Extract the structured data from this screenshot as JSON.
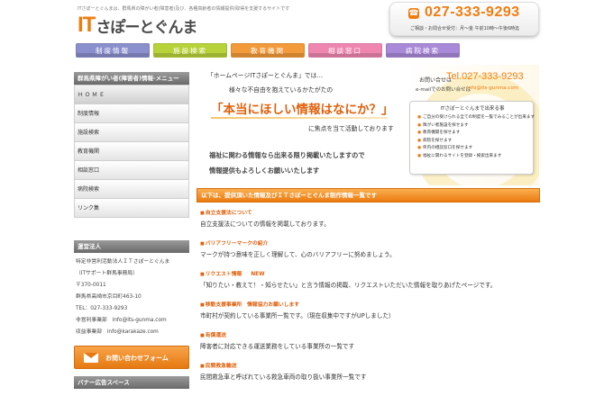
{
  "header": {
    "tagline": "ITさぽーとぐんまは、群馬県の障がい者(障害者)及び、各種高齢者の情報提供/取得を支援するサイトです",
    "logo_it": "IT",
    "logo_rest": "さぽーとぐんま",
    "phone_icon": "phone-icon",
    "phone": "027-333-9293",
    "hours": "ご相談・お問合せ受付：月～金 午前10時～午後6時迄"
  },
  "nav": [
    {
      "label": "制度情報",
      "color": "#8a8fcd"
    },
    {
      "label": "施設検索",
      "color": "#b8d23a"
    },
    {
      "label": "教育機関",
      "color": "#f39a3a"
    },
    {
      "label": "相談窓口",
      "color": "#ee86b0"
    },
    {
      "label": "病院検索",
      "color": "#a98ad8"
    }
  ],
  "sidebar": {
    "menu_title": "群馬県障がい者(障害者)情報-メニュー",
    "items": [
      "ＨＯＭＥ",
      "制度情報",
      "施設検索",
      "教育機関",
      "相談窓口",
      "病院検索",
      "リンク集"
    ],
    "org_title": "運営法人",
    "org_lines": [
      "特定非営利活動法人ＩＴさぽーとぐんま",
      "（ITサポート群馬事務局）",
      "〒370-0011",
      "群馬県高崎市京目町463-10",
      "TEL：027-333-9293",
      "非営利事業部　info@its-gunma.com",
      "収益事業部　info@karakaze.com"
    ],
    "contact_button": "お問い合わせフォーム",
    "banner_title": "バナー広告スペース"
  },
  "hero": {
    "line1": "「ホームページITさぽーとぐんま」では…",
    "line2": "様々な不自由を抱えているかたがたの",
    "big": "「本当にほしい情報はなにか？」",
    "line3": "に焦点を当て活動しております",
    "line4": "福祉に関わる情報なら出来る限り掲載いたしますので",
    "line5": "情報提供もよろしくお願いいたします",
    "contact_label": "お問い合せは",
    "contact_tel": "Tel.027-333-9293",
    "mail_label": "e-mailでのお問い合せは",
    "mail": "info@its-gunma.com",
    "list_title": "ITさぽーとぐんまで出来る事",
    "list_items": [
      "ご自分の受けられる全ての制度を一覧でみることが出来ます",
      "障がい者施設を探せます",
      "教育機関を探せます",
      "病院を探せます",
      "県内の相談窓口を探せます",
      "福祉に関わるサイトを登録・検索出来ます"
    ]
  },
  "main": {
    "section_title": "以下は、提供頂いた情報及びＩＴさぽーとぐんま制作情報一覧です",
    "items": [
      {
        "title": "自立支援法について",
        "body": "自立支援法についての情報を掲載しております。"
      },
      {
        "title": "バリアフリーマークの紹介",
        "body": "マークが持つ意味を正しく理解して、心のバリアフリーに努めましょう。"
      },
      {
        "title": "リクエスト情報",
        "new": "NEW",
        "body": "「知りたい・教えて！・知らせたい」と言う情報の掲載、リクエストいただいた情報を取りあげたページです。"
      },
      {
        "title": "移動支援事業所　情報協力お願いします",
        "body": "市町村が契約している事業所一覧です。（現在収集中ですがUPしました）"
      },
      {
        "title": "有償運送",
        "body": "障害者に対応できる運送業務をしている事業所の一覧です"
      },
      {
        "title": "民間救急輸送",
        "body": "民間救急車と呼ばれている救急車両の取り扱い事業所一覧です"
      }
    ]
  }
}
